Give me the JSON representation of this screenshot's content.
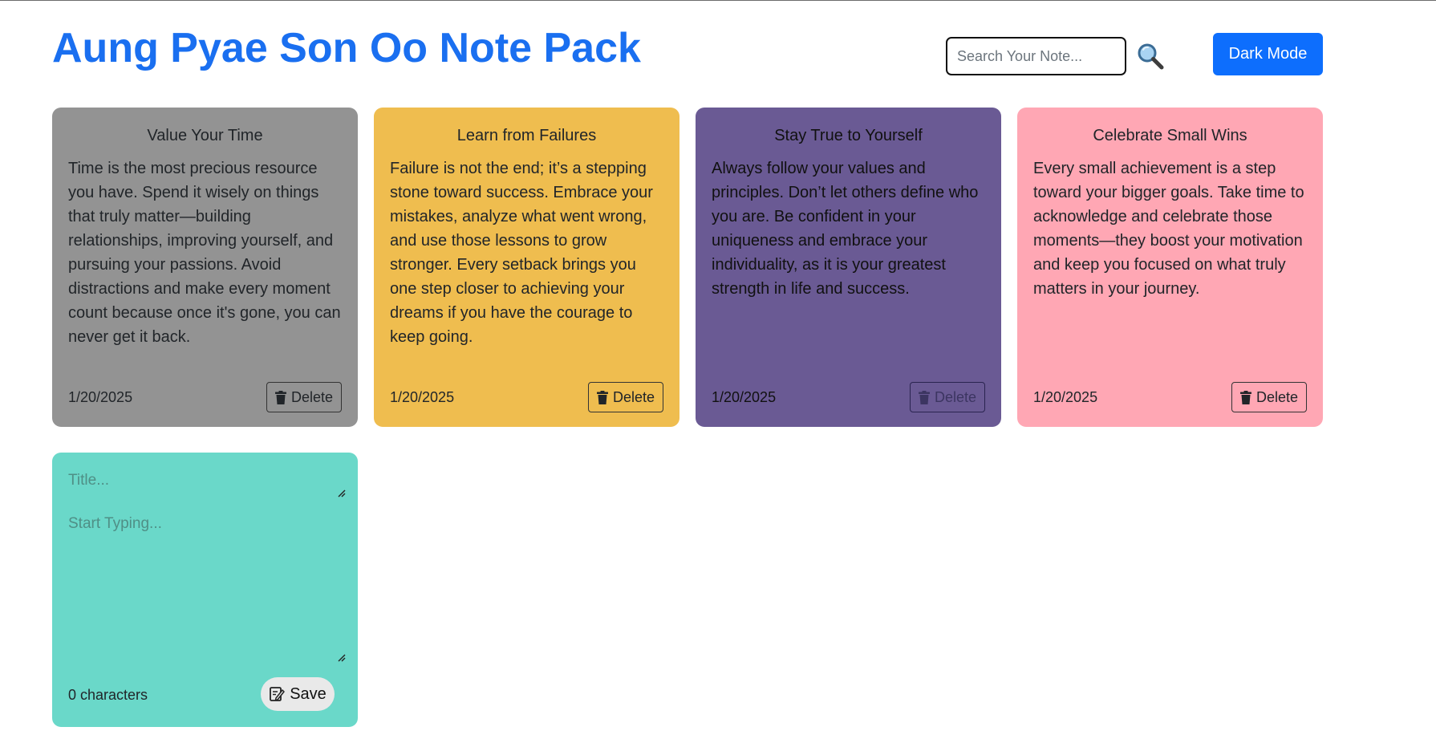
{
  "header": {
    "title": "Aung Pyae Son Oo Note Pack",
    "search_placeholder": "Search Your Note...",
    "search_icon": "magnifier-icon",
    "dark_mode_label": "Dark Mode"
  },
  "notes": [
    {
      "title": "Value Your Time",
      "body": "Time is the most precious resource you have. Spend it wisely on things that truly matter—building relationships, improving yourself, and pursuing your passions. Avoid distractions and make every moment count because once it's gone, you can never get it back.",
      "date": "1/20/2025",
      "delete_label": "Delete",
      "color": "#939393"
    },
    {
      "title": "Learn from Failures",
      "body": "Failure is not the end; it’s a stepping stone toward success. Embrace your mistakes, analyze what went wrong, and use those lessons to grow stronger. Every setback brings you one step closer to achieving your dreams if you have the courage to keep going.",
      "date": "1/20/2025",
      "delete_label": "Delete",
      "color": "#efbd4f"
    },
    {
      "title": "Stay True to Yourself",
      "body": "Always follow your values and principles. Don’t let others define who you are. Be confident in your uniqueness and embrace your individuality, as it is your greatest strength in life and success.",
      "date": "1/20/2025",
      "delete_label": "Delete",
      "color": "#6a5a94"
    },
    {
      "title": "Celebrate Small Wins",
      "body": "Every small achievement is a step toward your bigger goals. Take time to acknowledge and celebrate those moments—they boost your motivation and keep you focused on what truly matters in your journey.",
      "date": "1/20/2025",
      "delete_label": "Delete",
      "color": "#ffa7b4"
    }
  ],
  "new_note": {
    "title_placeholder": "Title...",
    "body_placeholder": "Start Typing...",
    "char_count": "0 characters",
    "save_label": "Save",
    "color": "#6ad8c9"
  },
  "colors": {
    "accent": "#1a6ff0",
    "button_primary": "#0d6efd"
  }
}
